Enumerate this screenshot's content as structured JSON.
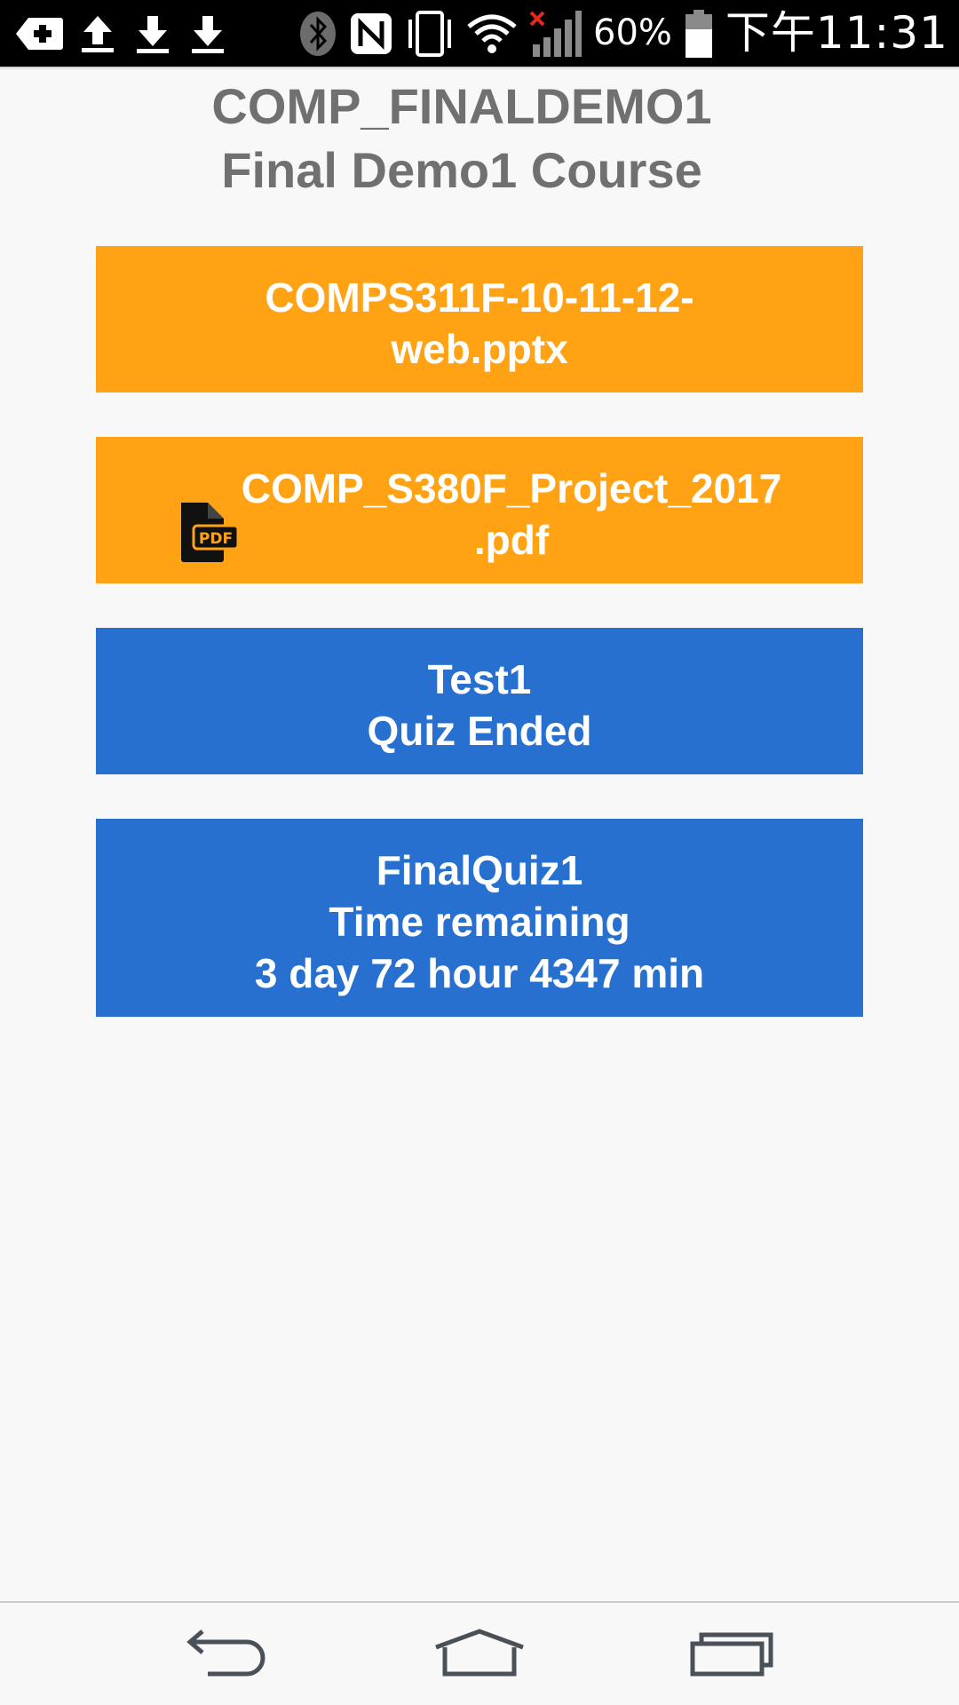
{
  "status_bar": {
    "battery_percent": "60%",
    "clock": "下午11:31",
    "icons": [
      "add-notification-icon",
      "upload-icon",
      "download-icon",
      "download-icon",
      "bluetooth-icon",
      "nfc-icon",
      "vibrate-icon",
      "wifi-icon",
      "signal-no-service-icon",
      "battery-icon"
    ]
  },
  "header": {
    "course_code": "COMP_FINALDEMO1",
    "course_name": "Final Demo1 Course"
  },
  "items": [
    {
      "type": "file",
      "line1": "COMPS311F-10-11-12-",
      "line2": "web.pptx",
      "color": "#ffa314"
    },
    {
      "type": "file",
      "icon": "pdf-file-icon",
      "line1": "COMP_S380F_Project_2017",
      "line2": ".pdf",
      "color": "#ffa314"
    },
    {
      "type": "quiz",
      "title": "Test1",
      "status": "Quiz Ended",
      "color": "#2870cf"
    },
    {
      "type": "quiz",
      "title": "FinalQuiz1",
      "status": "Time remaining",
      "remaining": "3 day 72 hour 4347 min",
      "color": "#2870cf"
    }
  ],
  "nav_bar": {
    "buttons": [
      "back-icon",
      "home-icon",
      "recent-apps-icon"
    ]
  }
}
